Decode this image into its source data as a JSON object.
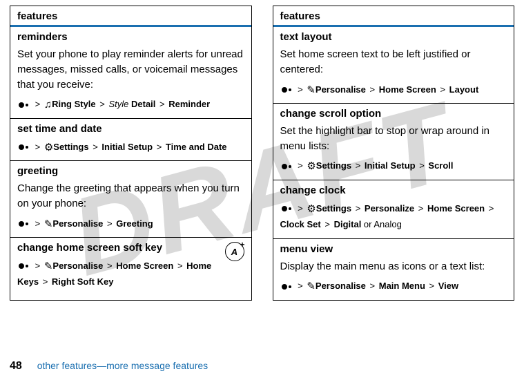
{
  "watermark": "DRAFT",
  "page_number": "48",
  "footer_text": "other features—more message features",
  "header_label": "features",
  "glyphs": {
    "gt": ">"
  },
  "left": [
    {
      "title": "reminders",
      "desc": "Set your phone to play reminder alerts for unread messages, missed calls, or voicemail messages that you receive:",
      "path_parts": [
        "dot",
        "gt",
        "ring-icon",
        "b:Ring Style",
        "gt",
        "i:Style",
        "b:Detail",
        "gt",
        "b:Reminder"
      ]
    },
    {
      "title": "set time and date",
      "desc": "",
      "path_parts": [
        "dot",
        "gt",
        "settings-icon",
        "b:Settings",
        "gt",
        "b:Initial Setup",
        "gt",
        "b:Time and Date"
      ]
    },
    {
      "title": "greeting",
      "desc": "Change the greeting that appears when you turn on your phone:",
      "path_parts": [
        "dot",
        "gt",
        "personalise-icon",
        "b:Personalise",
        "gt",
        "b:Greeting"
      ]
    },
    {
      "title": "change home screen soft key",
      "badge": true,
      "desc": "",
      "path_parts": [
        "dot",
        "gt",
        "personalise-icon",
        "b:Personalise",
        "gt",
        "b:Home Screen",
        "gt",
        "b:Home Keys",
        "gt",
        "b:Right Soft Key"
      ]
    }
  ],
  "right": [
    {
      "title": "text layout",
      "desc": "Set home screen text to be left justified or centered:",
      "path_parts": [
        "dot",
        "gt",
        "personalise-icon",
        "b:Personalise",
        "gt",
        "b:Home Screen",
        "gt",
        "b:Layout"
      ]
    },
    {
      "title": "change scroll option",
      "desc": "Set the highlight bar to stop or wrap around in menu lists:",
      "path_parts": [
        "dot",
        "gt",
        "settings-icon",
        "b:Settings",
        "gt",
        "b:Initial Setup",
        "gt",
        "b:Scroll"
      ]
    },
    {
      "title": "change clock",
      "desc": "",
      "path_parts": [
        "dot",
        "gt",
        "settings-icon",
        "b:Settings",
        "gt",
        "b:Personalize",
        "gt",
        "b:Home Screen",
        "gt",
        "b:Clock Set",
        "gt",
        "b:Digital",
        "t: or ",
        "t:Analog"
      ]
    },
    {
      "title": "menu view",
      "desc": "Display the main menu as icons or a text list:",
      "path_parts": [
        "dot",
        "gt",
        "personalise-icon",
        "b:Personalise",
        "gt",
        "b:Main Menu",
        "gt",
        "b:View"
      ]
    }
  ],
  "icons": {
    "ring-icon": "♫",
    "settings-icon": "⚙",
    "personalise-icon": "✎"
  }
}
